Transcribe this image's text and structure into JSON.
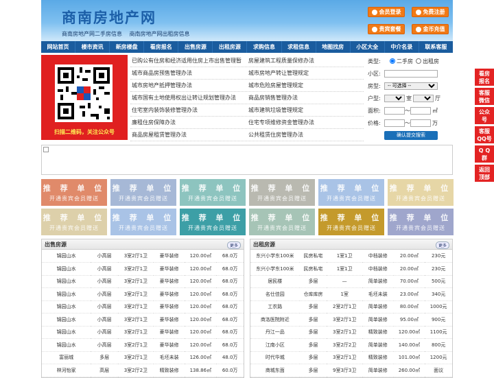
{
  "header": {
    "site_name": "商南房地产网",
    "sublinks": [
      "商南房地产网二手房信息",
      "商南房地产网出租房信息"
    ],
    "buttons": {
      "member_login": "会员登录",
      "free_register": "免费注册",
      "vip_package": "贵宾套餐",
      "coin_recharge": "金币充值"
    }
  },
  "nav": [
    "网站首页",
    "楼市资讯",
    "新房楼盘",
    "看房报名",
    "出售房源",
    "出租房源",
    "求购信息",
    "求租信息",
    "地图找房",
    "小区大全",
    "中介名录",
    "联系客服"
  ],
  "qr": {
    "caption": "扫描二维码，关注公众号"
  },
  "info_links": [
    [
      "已购公有住房和经济适用住房上市出售管理暂",
      "房屋建筑工程质量保修办法"
    ],
    [
      "城市商品房预售管理办法",
      "城市房地产转让管理规定"
    ],
    [
      "城市房地产抵押管理办法",
      "城市危险房屋管理规定"
    ],
    [
      "城市国有土地使用权出让转让规划管理办法",
      "商品房销售管理办法"
    ],
    [
      "住宅室内装饰装修管理办法",
      "城市建筑垃圾管理规定"
    ],
    [
      "廉租住房保障办法",
      "住宅专项维修资金管理办法"
    ],
    [
      "商品房屋租赁管理办法",
      "公共租赁住房管理办法"
    ]
  ],
  "search": {
    "type_label": "类型:",
    "type_options": [
      "二手房",
      "出租房"
    ],
    "community_label": "小区:",
    "house_type_label": "房型:",
    "house_type_value": "-- 可选择 --",
    "layout_label": "户型:",
    "room_unit": "室",
    "hall_unit": "厅",
    "area_label": "面积:",
    "area_unit": "㎡",
    "price_label": "价格:",
    "price_unit": "万",
    "range_sep": "～",
    "submit": "确认提交搜索"
  },
  "recommend": {
    "title": "推 荐 单 位",
    "sub": "开通贵宾会员赠送",
    "colors": [
      "#e08a6a",
      "#a6b8d6",
      "#8dc4bf",
      "#b9b9b0",
      "#a9c3e6",
      "#e6d6a6",
      "#ddd0aa",
      "#a9c3e6",
      "#3d9fa6",
      "#a6c4b6",
      "#c49a2c",
      "#9fa6cc"
    ]
  },
  "sale": {
    "title": "出售房源",
    "more": "更多",
    "rows": [
      [
        "锦园山水",
        "小高层",
        "3室2厅1卫",
        "豪华装修",
        "120.00㎡",
        "68.0万"
      ],
      [
        "锦园山水",
        "小高层",
        "3室2厅1卫",
        "豪华装修",
        "120.00㎡",
        "68.0万"
      ],
      [
        "锦园山水",
        "小高层",
        "3室2厅1卫",
        "豪华装修",
        "120.00㎡",
        "68.0万"
      ],
      [
        "锦园山水",
        "小高层",
        "3室2厅1卫",
        "豪华装修",
        "120.00㎡",
        "68.0万"
      ],
      [
        "锦园山水",
        "小高层",
        "3室2厅1卫",
        "豪华装修",
        "120.00㎡",
        "68.0万"
      ],
      [
        "锦园山水",
        "小高层",
        "3室2厅1卫",
        "豪华装修",
        "120.00㎡",
        "68.0万"
      ],
      [
        "锦园山水",
        "小高层",
        "3室2厅1卫",
        "豪华装修",
        "120.00㎡",
        "68.0万"
      ],
      [
        "锦园山水",
        "小高层",
        "3室2厅1卫",
        "豪华装修",
        "120.00㎡",
        "68.0万"
      ],
      [
        "富丽城",
        "多层",
        "3室2厅1卫",
        "毛坯未装",
        "126.00㎡",
        "48.0万"
      ],
      [
        "林河怡家",
        "高层",
        "3室2厅2卫",
        "精致装修",
        "138.86㎡",
        "60.0万"
      ]
    ]
  },
  "rent": {
    "title": "出租房源",
    "more": "更多",
    "rows": [
      [
        "东兴小学东100米",
        "民房私宅",
        "1室1卫",
        "中档装修",
        "20.00㎡",
        "230元"
      ],
      [
        "东兴小学东100米",
        "民房私宅",
        "1室1卫",
        "中档装修",
        "20.00㎡",
        "230元"
      ],
      [
        "居民楼",
        "多层",
        "—",
        "简单装修",
        "70.00㎡",
        "500元"
      ],
      [
        "名仕佳园",
        "仓库库房",
        "1室",
        "毛坯未装",
        "23.00㎡",
        "340元"
      ],
      [
        "工农路",
        "多层",
        "2室2厅1卫",
        "简单装修",
        "80.00㎡",
        "1000元"
      ],
      [
        "商洛医院附近",
        "多层",
        "3室2厅1卫",
        "简单装修",
        "95.00㎡",
        "900元"
      ],
      [
        "丹江一品",
        "多层",
        "3室2厅1卫",
        "精致装修",
        "120.00㎡",
        "1100元"
      ],
      [
        "江南小区",
        "多层",
        "3室2厅2卫",
        "简单装修",
        "140.00㎡",
        "800元"
      ],
      [
        "时代华城",
        "多层",
        "3室2厅1卫",
        "精致装修",
        "101.00㎡",
        "1200元"
      ],
      [
        "商城东面",
        "多层",
        "9室3厅3卫",
        "简单装修",
        "260.00㎡",
        "面议"
      ]
    ]
  },
  "side": [
    [
      "看房",
      "报名"
    ],
    [
      "客服",
      "微信"
    ],
    [
      "公众",
      "号"
    ],
    [
      "客服",
      "QQ号"
    ],
    [
      "Q Q",
      "群"
    ],
    [
      "返回",
      "顶部"
    ]
  ]
}
